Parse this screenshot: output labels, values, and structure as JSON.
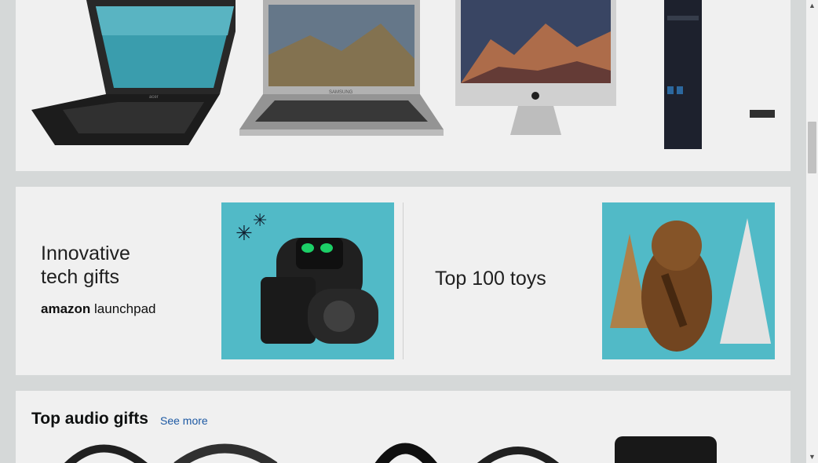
{
  "products": [
    {
      "name": "Acer Chromebook laptop",
      "logo_text": "acer"
    },
    {
      "name": "Samsung Chromebook laptop",
      "logo_text": "SAMSUNG"
    },
    {
      "name": "Apple iMac desktop"
    },
    {
      "name": "Tower desktop computer"
    }
  ],
  "promos": [
    {
      "headline_line1": "Innovative",
      "headline_line2": "tech gifts",
      "brand_light": "amazon",
      "brand_bold": "launchpad"
    },
    {
      "headline_line1": "Top 100 toys"
    }
  ],
  "audio_section": {
    "title": "Top audio gifts",
    "see_more": "See more"
  },
  "colors": {
    "page_bg": "#e3e6e6",
    "card_bg": "#ffffff",
    "promo_teal": "#57c6d4",
    "link_blue": "#1f5fae"
  }
}
